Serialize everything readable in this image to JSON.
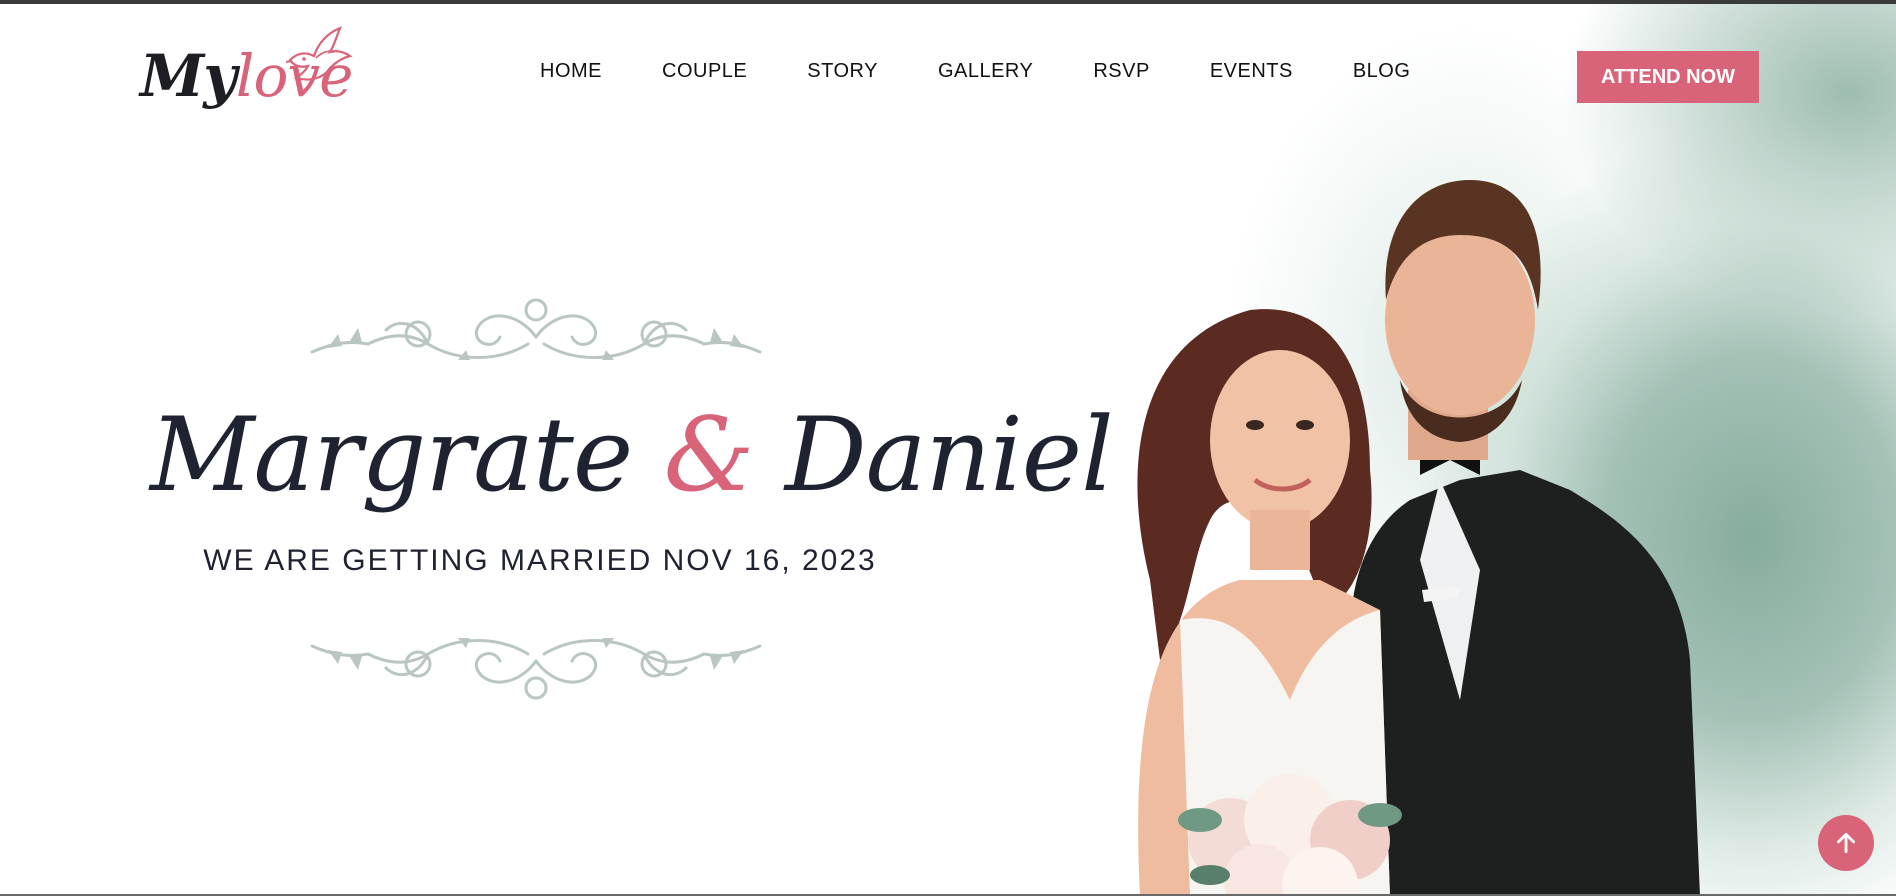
{
  "brand": {
    "logo_dark": "My",
    "logo_pink": "love"
  },
  "nav": {
    "items": [
      {
        "label": "HOME"
      },
      {
        "label": "COUPLE"
      },
      {
        "label": "STORY"
      },
      {
        "label": "GALLERY"
      },
      {
        "label": "RSVP"
      },
      {
        "label": "EVENTS"
      },
      {
        "label": "BLOG"
      }
    ],
    "cta_label": "ATTEND NOW"
  },
  "hero": {
    "name_one": "Margrate",
    "ampersand": "&",
    "name_two": "Daniel",
    "subtitle": "WE ARE GETTING MARRIED NOV 16, 2023"
  },
  "colors": {
    "accent": "#d9647a",
    "text_dark": "#1f2230",
    "flourish": "#b9c6c2",
    "wash_green": "#86ad9e"
  },
  "icons": [
    "dove-icon",
    "arrow-up-icon"
  ]
}
